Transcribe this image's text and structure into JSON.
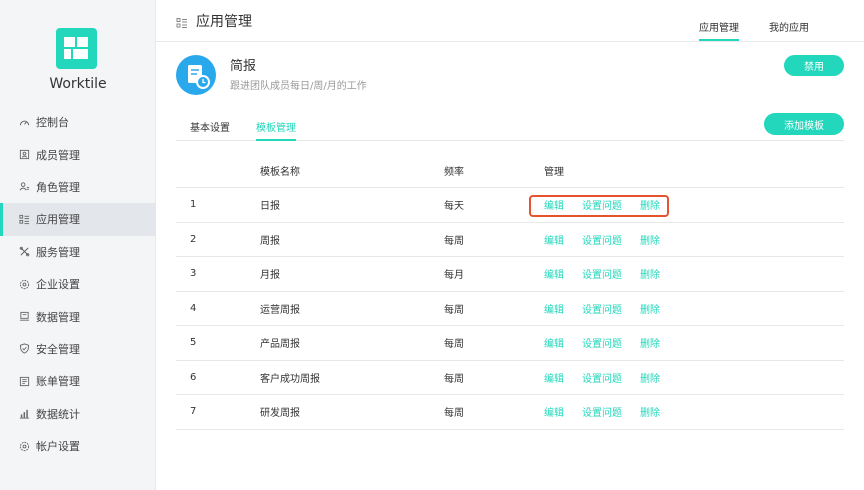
{
  "brand": {
    "name": "Worktile"
  },
  "sidebar": {
    "items": [
      {
        "label": "控制台",
        "icon": "dashboard-icon"
      },
      {
        "label": "成员管理",
        "icon": "member-icon"
      },
      {
        "label": "角色管理",
        "icon": "role-icon"
      },
      {
        "label": "应用管理",
        "icon": "apps-icon",
        "active": true
      },
      {
        "label": "服务管理",
        "icon": "service-icon"
      },
      {
        "label": "企业设置",
        "icon": "settings-icon"
      },
      {
        "label": "数据管理",
        "icon": "data-icon"
      },
      {
        "label": "安全管理",
        "icon": "shield-icon"
      },
      {
        "label": "账单管理",
        "icon": "bill-icon"
      },
      {
        "label": "数据统计",
        "icon": "stats-icon"
      },
      {
        "label": "帐户设置",
        "icon": "account-icon"
      }
    ]
  },
  "header": {
    "title": "应用管理",
    "tabs": [
      {
        "label": "应用管理",
        "active": true
      },
      {
        "label": "我的应用",
        "active": false
      }
    ]
  },
  "app": {
    "title": "简报",
    "description": "跟进团队成员每日/周/月的工作",
    "disable_label": "禁用"
  },
  "sub_tabs": [
    {
      "label": "基本设置",
      "active": false
    },
    {
      "label": "模板管理",
      "active": true
    }
  ],
  "add_template_label": "添加模板",
  "table": {
    "headers": {
      "name": "模板名称",
      "freq": "频率",
      "mgmt": "管理"
    },
    "actions": {
      "edit": "编辑",
      "questions": "设置问题",
      "delete": "删除"
    },
    "rows": [
      {
        "idx": "1",
        "name": "日报",
        "freq": "每天"
      },
      {
        "idx": "2",
        "name": "周报",
        "freq": "每周"
      },
      {
        "idx": "3",
        "name": "月报",
        "freq": "每月"
      },
      {
        "idx": "4",
        "name": "运营周报",
        "freq": "每周"
      },
      {
        "idx": "5",
        "name": "产品周报",
        "freq": "每周"
      },
      {
        "idx": "6",
        "name": "客户成功周报",
        "freq": "每周"
      },
      {
        "idx": "7",
        "name": "研发周报",
        "freq": "每周"
      }
    ]
  },
  "colors": {
    "accent": "#22d7bb",
    "active_bg": "#e3e6eb",
    "sidebar_bg": "#f4f5f7",
    "highlight": "#e5532f",
    "app_icon": "#2aa8ec"
  }
}
